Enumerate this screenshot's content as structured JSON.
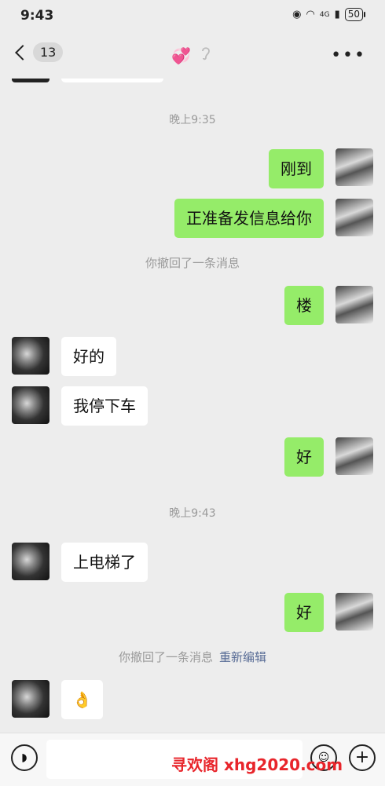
{
  "status": {
    "time": "9:43",
    "network": "4G",
    "battery": "50"
  },
  "header": {
    "unread_count": "13"
  },
  "icons": {
    "back": "back-chevron-icon",
    "hearts": "two-hearts-icon",
    "ear": "ear-icon",
    "more": "more-icon",
    "voice": "voice-icon",
    "emoji": "emoji-icon",
    "plus": "plus-icon"
  },
  "colors": {
    "me_bubble": "#95ec69",
    "them_bubble": "#ffffff",
    "background": "#ededed",
    "link": "#576b95",
    "watermark": "#e8252b"
  },
  "messages": {
    "ts1": "晚上9:35",
    "m1": "刚到",
    "m2": "正准备发信息给你",
    "recall1": "你撤回了一条消息",
    "m3": "楼",
    "m4": "好的",
    "m5": "我停下车",
    "m6": "好",
    "ts2": "晚上9:43",
    "m7": "上电梯了",
    "m8": "好",
    "recall2": "你撤回了一条消息",
    "reedit": "重新编辑",
    "m9": "👌"
  },
  "watermark": "寻欢阁 xhg2020.com"
}
